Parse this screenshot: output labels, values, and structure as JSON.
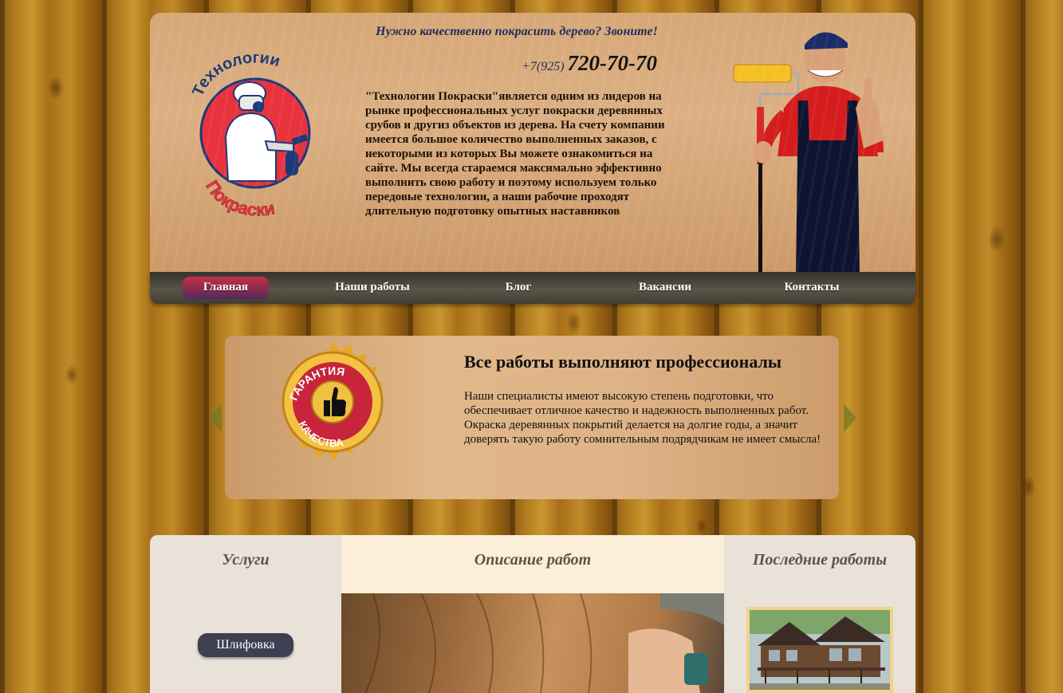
{
  "header": {
    "tagline": "Нужно качественно покрасить дерево? Звоните!",
    "phone_code": "+7(925)",
    "phone_number": "720-70-70",
    "intro": "\"Технологии Покраски\"является одним из лидеров на рынке профессиональных услуг покраски деревянных срубов и другиз объектов из дерева. На счету компании имеется большое количество выполненных заказов, с некоторыми из которых Вы можете ознакомиться на сайте. Мы всегда стараемся максимально эффективно выполнить свою работу и поэтому используем только передовые технологии, а наши рабочие проходят длительную подготовку опытных наставников",
    "logo": {
      "icon": "painter-logo",
      "text_top": "Технологии",
      "text_bottom": "Покраски"
    }
  },
  "nav": {
    "items": [
      {
        "label": "Главная",
        "active": true
      },
      {
        "label": "Наши работы",
        "active": false
      },
      {
        "label": "Блог",
        "active": false
      },
      {
        "label": "Вакансии",
        "active": false
      },
      {
        "label": "Контакты",
        "active": false
      }
    ]
  },
  "slider": {
    "title": "Все работы выполняют профессионалы",
    "text": "Наши специалисты имеют высокую степень подготовки, что обеспечивает отличное качество и надежность выполненных работ. Окраска деревянных покрытий делается на долгие годы, а значит доверять такую работу сомнительным подрядчикам не имеет смысла!",
    "badge": {
      "icon": "quality-guarantee-badge",
      "text_top": "ГАРАНТИЯ",
      "text_bottom": "КАЧЕСТВА"
    }
  },
  "columns": {
    "left_title": "Услуги",
    "mid_title": "Описание работ",
    "right_title": "Последние работы",
    "services": [
      "Шлифовка"
    ]
  },
  "colors": {
    "nav_active": "#c13044",
    "nav_bg": "#4a463d",
    "tagline": "#1f2c5c",
    "service_btn": "#3e3f52"
  }
}
